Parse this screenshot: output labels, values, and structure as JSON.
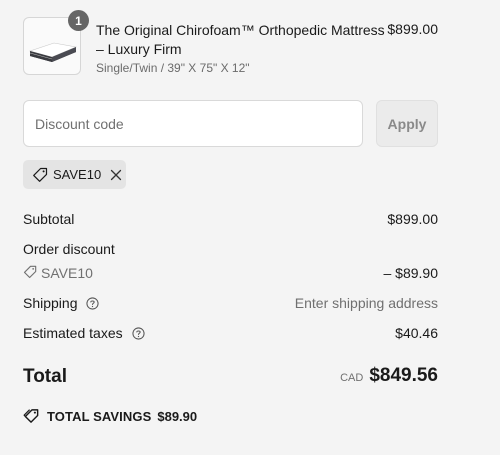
{
  "cart_item": {
    "quantity": "1",
    "title": "The Original Chirofoam™ Orthopedic Mattress – Luxury Firm",
    "variant": "Single/Twin / 39\" X 75\" X 12\"",
    "price": "$899.00",
    "image_icon": "mattress-image"
  },
  "discount": {
    "placeholder": "Discount code",
    "value": "",
    "apply_label": "Apply",
    "applied_code": "SAVE10"
  },
  "summary": {
    "subtotal_label": "Subtotal",
    "subtotal_value": "$899.00",
    "order_discount_label": "Order discount",
    "order_discount_code": "SAVE10",
    "order_discount_value": "– $89.90",
    "shipping_label": "Shipping",
    "shipping_value": "Enter shipping address",
    "taxes_label": "Estimated taxes",
    "taxes_value": "$40.46"
  },
  "total": {
    "label": "Total",
    "currency": "CAD",
    "amount": "$849.56"
  },
  "savings": {
    "label": "TOTAL SAVINGS",
    "amount": "$89.90"
  },
  "colors": {
    "background": "#f4f4f4",
    "chip": "#e4e4e4",
    "badge": "#666666",
    "muted_text": "#707070"
  }
}
